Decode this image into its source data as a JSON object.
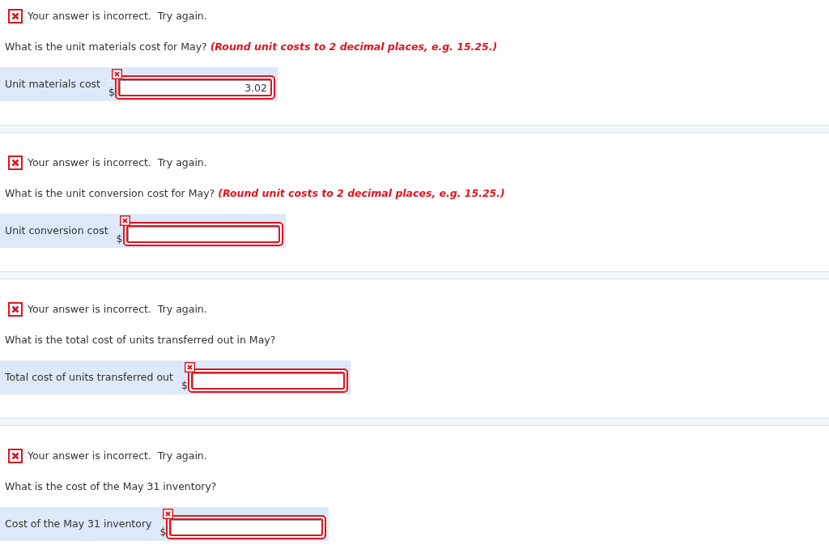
{
  "questions": [
    {
      "feedback": {
        "correct": false,
        "text": "Your answer is incorrect.  Try again."
      },
      "question": {
        "text": "What is the unit materials cost for May?",
        "hint": "(Round unit costs to 2 decimal places, e.g. 15.25.)"
      },
      "answer": {
        "label": "Unit materials cost",
        "currency": "$",
        "value": "3.02",
        "incorrect": true
      }
    },
    {
      "feedback": {
        "correct": false,
        "text": "Your answer is incorrect.  Try again."
      },
      "question": {
        "text": "What is the unit conversion cost for May?",
        "hint": "(Round unit costs to 2 decimal places, e.g. 15.25.)"
      },
      "answer": {
        "label": "Unit conversion cost",
        "currency": "$",
        "incorrect": true
      }
    },
    {
      "feedback": {
        "correct": false,
        "text": "Your answer is incorrect.  Try again."
      },
      "question": {
        "text": "What is the total cost of units transferred out in May?"
      },
      "answer": {
        "label": "Total cost of units transferred out",
        "currency": "$",
        "incorrect": true
      }
    },
    {
      "feedback": {
        "correct": false,
        "text": "Your answer is incorrect.  Try again."
      },
      "question": {
        "text": "What is the cost of the May 31 inventory?"
      },
      "answer": {
        "label": "Cost of the May 31 inventory",
        "currency": "$",
        "incorrect": true
      }
    }
  ]
}
